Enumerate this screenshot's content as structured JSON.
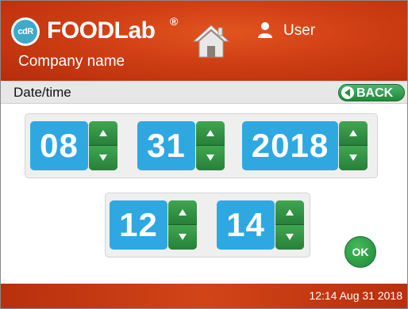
{
  "header": {
    "logo_badge": "cdR",
    "logo_text": "FOODLab",
    "logo_reg": "®",
    "company_name": "Company name",
    "user_label": "User",
    "home_icon": "home-icon",
    "user_icon": "user-icon"
  },
  "title_bar": {
    "title": "Date/time",
    "back_label": "BACK"
  },
  "date": {
    "month": "08",
    "day": "31",
    "year": "2018"
  },
  "time": {
    "hour": "12",
    "minute": "14"
  },
  "ok_label": "OK",
  "footer": {
    "clock": "12:14  Aug 31 2018"
  },
  "colors": {
    "header": "#cf3e14",
    "value_box": "#2fa8e2",
    "stepper": "#2f8f3e",
    "ok": "#1d8a37"
  }
}
